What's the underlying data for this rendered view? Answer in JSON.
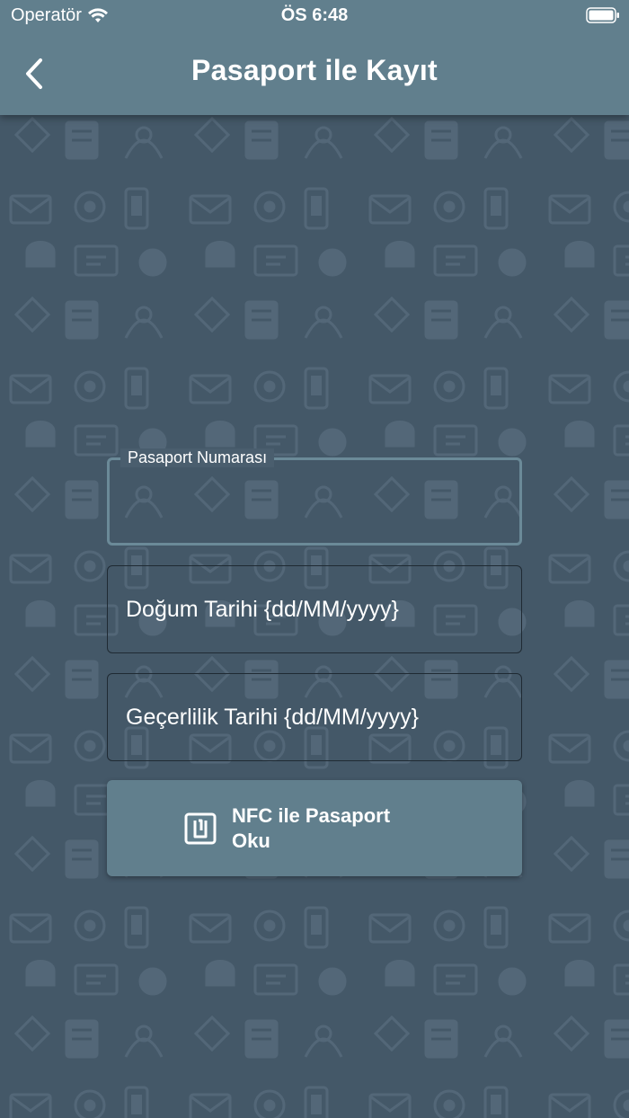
{
  "status_bar": {
    "carrier": "Operatör",
    "time": "ÖS 6:48"
  },
  "nav": {
    "title": "Pasaport ile Kayıt",
    "back_icon": "chevron-left-icon"
  },
  "form": {
    "passport_number": {
      "label": "Pasaport Numarası",
      "value": ""
    },
    "birth_date": {
      "placeholder": "Doğum Tarihi {dd/MM/yyyy}",
      "value": ""
    },
    "expiry_date": {
      "placeholder": "Geçerlilik Tarihi {dd/MM/yyyy}",
      "value": ""
    }
  },
  "nfc_button": {
    "line1": "NFC ile Pasaport",
    "line2": "Oku",
    "icon": "nfc-icon"
  },
  "colors": {
    "primary": "#617f8d",
    "background": "#445868",
    "text": "#ffffff"
  }
}
